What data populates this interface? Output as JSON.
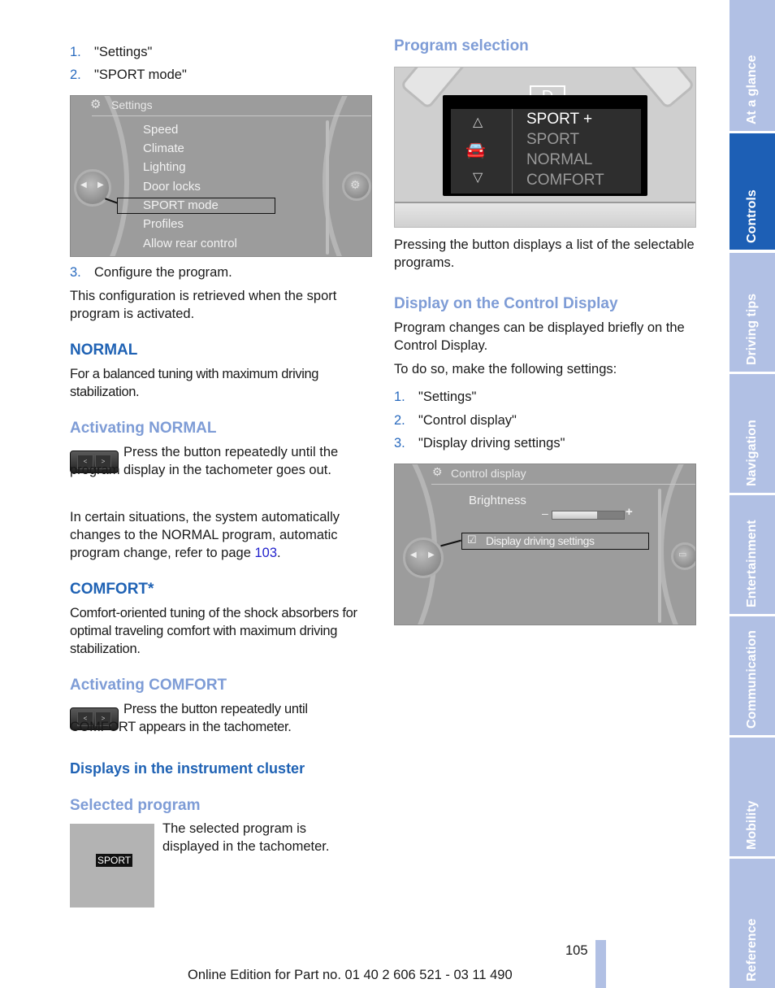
{
  "left": {
    "steps_a": [
      {
        "num": "1.",
        "text": "\"Settings\""
      },
      {
        "num": "2.",
        "text": "\"SPORT mode\""
      }
    ],
    "settings_screen": {
      "title": "Settings",
      "items": [
        "Speed",
        "Climate",
        "Lighting",
        "Door locks",
        "SPORT mode",
        "Profiles",
        "Allow rear control"
      ],
      "selected": "SPORT mode"
    },
    "step_3": {
      "num": "3.",
      "text": "Configure the program."
    },
    "config_note": "This configuration is retrieved when the sport program is activated.",
    "normal": {
      "heading": "NORMAL",
      "desc": "For a balanced tuning with maximum driving stabilization."
    },
    "activating_normal": {
      "heading": "Activating NORMAL",
      "instruction": "Press the button repeatedly until the program display in the tachometer goes out.",
      "auto_note_prefix": "In certain situations, the system automatically changes to the NORMAL program, automatic program change, refer to page ",
      "auto_note_link": "103",
      "auto_note_suffix": "."
    },
    "comfort": {
      "heading": "COMFORT*",
      "desc": "Comfort-oriented tuning of the shock absorbers for optimal traveling comfort with maximum driving stabilization."
    },
    "activating_comfort": {
      "heading": "Activating COMFORT",
      "instruction": "Press the button repeatedly until COMFORT appears in the tachometer."
    },
    "instrument_cluster": {
      "heading": "Displays in the instrument cluster",
      "selected_program_heading": "Selected program",
      "selected_program_text": "The selected program is displayed in the tachometer.",
      "badge": "SPORT"
    }
  },
  "right": {
    "program_selection": {
      "heading": "Program selection",
      "gear": "D",
      "programs": [
        "SPORT +",
        "SPORT",
        "NORMAL",
        "COMFORT"
      ],
      "active_program": "SPORT +",
      "desc": "Pressing the button displays a list of the selectable programs."
    },
    "control_display": {
      "heading": "Display on the Control Display",
      "desc": "Program changes can be displayed briefly on the Control Display.",
      "lead": "To do so, make the following settings:",
      "steps": [
        {
          "num": "1.",
          "text": "\"Settings\""
        },
        {
          "num": "2.",
          "text": "\"Control display\""
        },
        {
          "num": "3.",
          "text": "\"Display driving settings\""
        }
      ],
      "screen": {
        "title": "Control display",
        "brightness_label": "Brightness",
        "brightness_level": 0.62,
        "minus": "–",
        "plus": "+",
        "checkbox_label": "Display driving settings",
        "checkbox_checked": true
      }
    }
  },
  "footer": {
    "page_number": "105",
    "edition": "Online Edition for Part no. 01 40 2 606 521 - 03 11 490"
  },
  "side_tabs": [
    {
      "label": "At a glance",
      "active": false
    },
    {
      "label": "Controls",
      "active": true
    },
    {
      "label": "Driving tips",
      "active": false
    },
    {
      "label": "Navigation",
      "active": false
    },
    {
      "label": "Entertainment",
      "active": false
    },
    {
      "label": "Communication",
      "active": false
    },
    {
      "label": "Mobility",
      "active": false
    },
    {
      "label": "Reference",
      "active": false
    }
  ],
  "colors": {
    "heading_blue": "#1f62b4",
    "subheading_blue": "#7e9cd6",
    "tab_inactive": "#b1c0e4",
    "tab_active": "#1d5fb5"
  }
}
